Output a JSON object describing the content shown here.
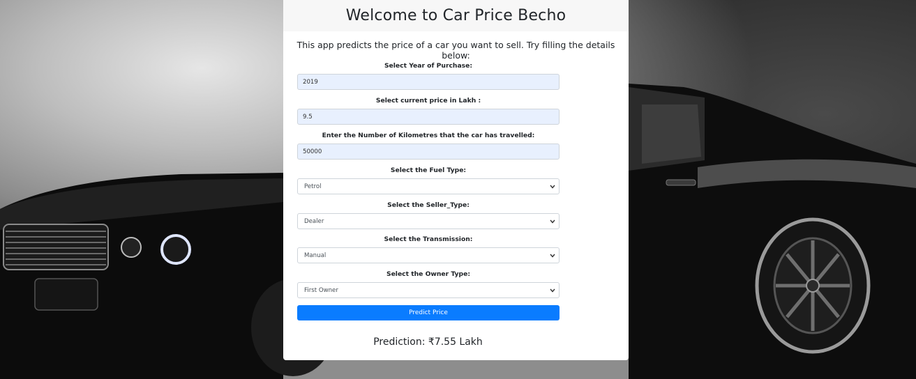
{
  "header": {
    "title": "Welcome to Car Price Becho"
  },
  "intro": "This app predicts the price of a car you want to sell. Try filling the details below:",
  "fields": {
    "year": {
      "label": "Select Year of Purchase:",
      "value": "2019"
    },
    "price": {
      "label": "Select current price in Lakh :",
      "value": "9.5"
    },
    "kms": {
      "label": "Enter the Number of Kilometres that the car has travelled:",
      "value": "50000"
    },
    "fuel": {
      "label": "Select the Fuel Type:",
      "value": "Petrol"
    },
    "seller": {
      "label": "Select the Seller_Type:",
      "value": "Dealer"
    },
    "transmission": {
      "label": "Select the Transmission:",
      "value": "Manual"
    },
    "owner": {
      "label": "Select the Owner Type:",
      "value": "First Owner"
    }
  },
  "predict_button": "Predict Price",
  "prediction": "Prediction: ₹7.55 Lakh",
  "colors": {
    "accent": "#0a7cff",
    "autofill": "#e8f0fe",
    "header_bg": "#f7f7f7"
  }
}
